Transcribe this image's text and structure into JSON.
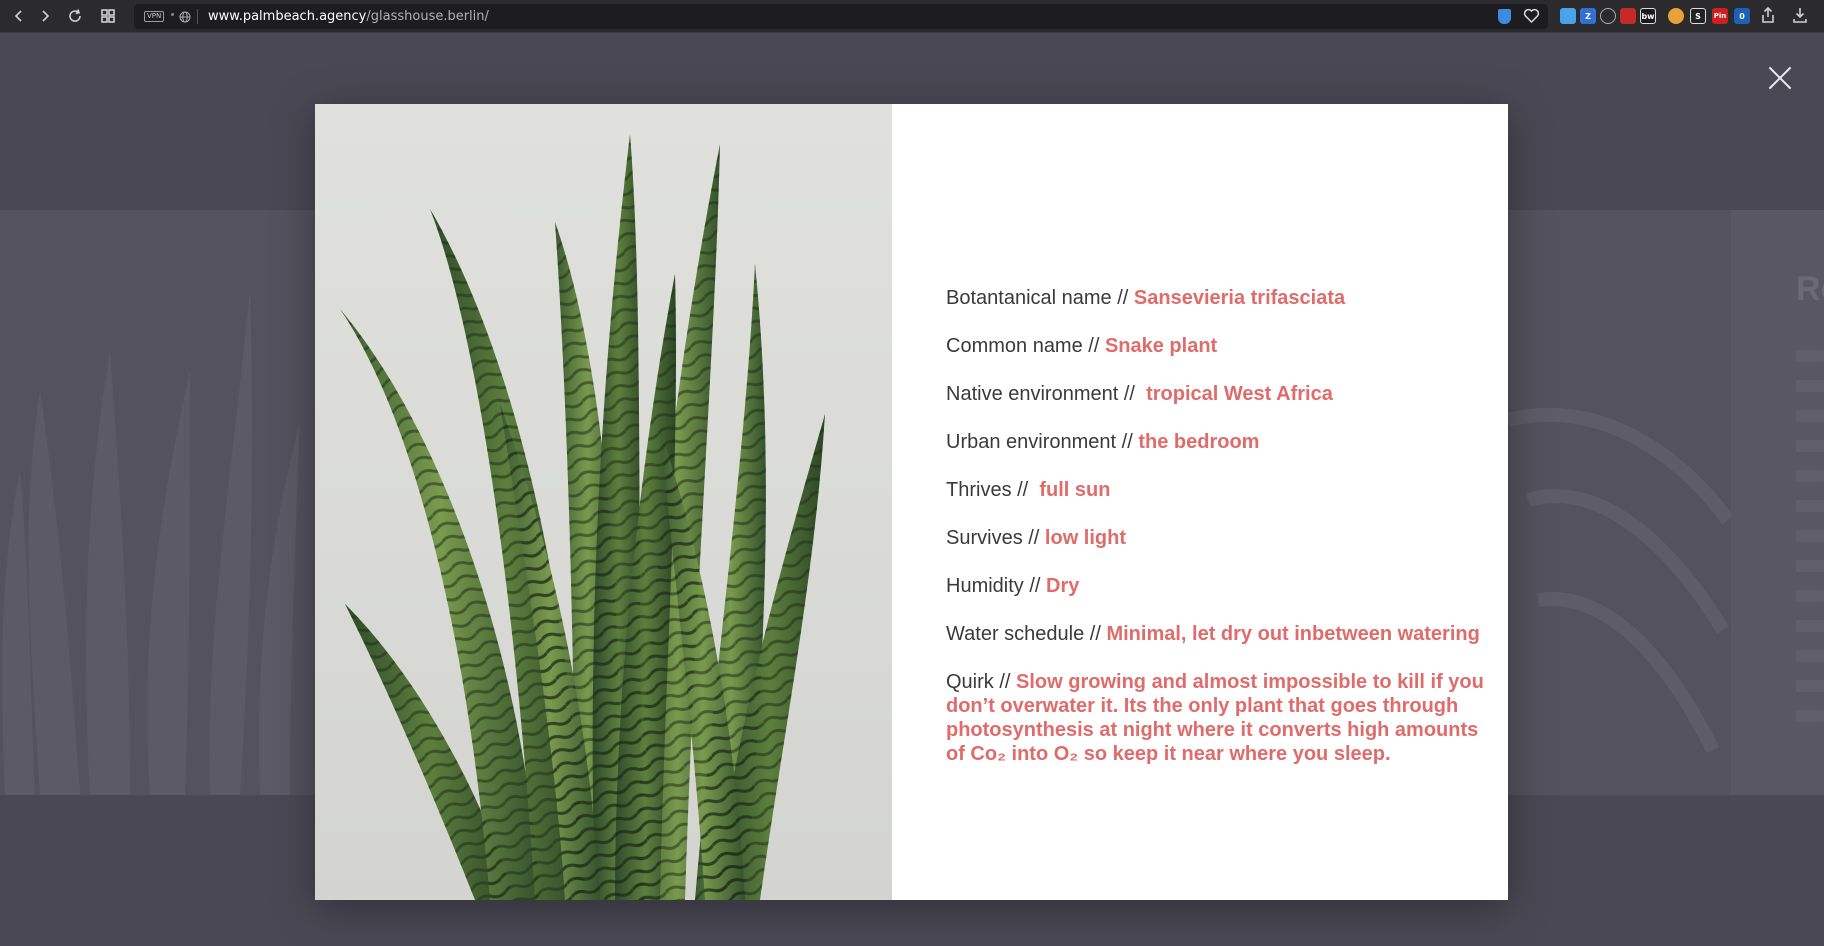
{
  "browser": {
    "vpn_label": "VPN",
    "url_domain": "www.palmbeach.agency",
    "url_path": "/glasshouse.berlin/",
    "extensions": [
      {
        "label": "Z",
        "color": "#2f6fd6"
      },
      {
        "label": "bw",
        "color": "#1a1a1a"
      },
      {
        "label": "S",
        "color": "#222222"
      },
      {
        "label": "Pin",
        "color": "#cc1f1f"
      },
      {
        "label": "0",
        "color": "#1f5fb8"
      }
    ]
  },
  "background": {
    "right_title": "Re"
  },
  "plant": {
    "rows": [
      {
        "label": "Botantanical name // ",
        "value": "Sansevieria trifasciata"
      },
      {
        "label": "Common name // ",
        "value": "Snake plant"
      },
      {
        "label": "Native environment //  ",
        "value": "tropical West Africa"
      },
      {
        "label": "Urban environment // ",
        "value": "the bedroom"
      },
      {
        "label": "Thrives //  ",
        "value": "full sun"
      },
      {
        "label": "Survives // ",
        "value": "low light"
      },
      {
        "label": "Humidity // ",
        "value": "Dry"
      },
      {
        "label": "Water schedule // ",
        "value": "Minimal, let dry out inbetween watering"
      },
      {
        "label": "Quirk // ",
        "value": "Slow growing and almost impossible to kill if you don’t overwater it. Its the only plant that goes through photosynthesis at night where it converts high amounts of Co₂ into O₂ so keep it near where you sleep."
      }
    ]
  },
  "colors": {
    "accent": "#e06b6b",
    "overlay": "#4a4854",
    "text": "#3a3a3a"
  }
}
